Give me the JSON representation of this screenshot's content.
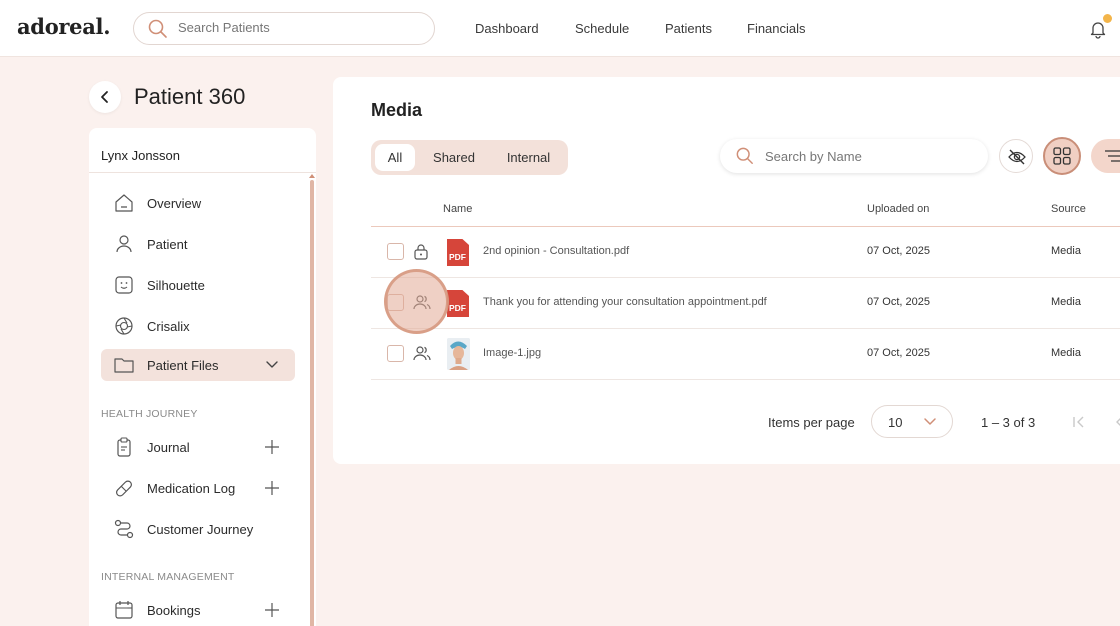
{
  "app": {
    "logo": "adoreal."
  },
  "header": {
    "search_placeholder": "Search Patients",
    "nav": [
      "Dashboard",
      "Schedule",
      "Patients",
      "Financials"
    ]
  },
  "page": {
    "title": "Patient 360"
  },
  "sidebar": {
    "patient_name": "Lynx Jonsson",
    "items": [
      {
        "label": "Overview",
        "icon": "home-icon"
      },
      {
        "label": "Patient",
        "icon": "person-icon"
      },
      {
        "label": "Silhouette",
        "icon": "face-scan-icon"
      },
      {
        "label": "Crisalix",
        "icon": "aperture-icon"
      },
      {
        "label": "Patient Files",
        "icon": "folder-icon",
        "active": true
      }
    ],
    "section_health": "HEALTH JOURNEY",
    "health_items": [
      {
        "label": "Journal",
        "icon": "clipboard-icon"
      },
      {
        "label": "Medication Log",
        "icon": "pill-icon"
      },
      {
        "label": "Customer Journey",
        "icon": "route-icon"
      }
    ],
    "section_internal": "INTERNAL MANAGEMENT",
    "internal_items": [
      {
        "label": "Bookings",
        "icon": "calendar-icon"
      }
    ]
  },
  "media": {
    "title": "Media",
    "tabs": [
      "All",
      "Shared",
      "Internal"
    ],
    "active_tab": "All",
    "search_placeholder": "Search by Name",
    "columns": {
      "name": "Name",
      "uploaded": "Uploaded on",
      "source": "Source"
    },
    "rows": [
      {
        "access": "lock-icon",
        "type": "pdf",
        "name": "2nd opinion - Consultation.pdf",
        "date": "07 Oct, 2025",
        "source": "Media"
      },
      {
        "access": "users-icon",
        "type": "pdf",
        "name": "Thank you for attending your consultation appointment.pdf",
        "date": "07 Oct, 2025",
        "source": "Media"
      },
      {
        "access": "users-icon",
        "type": "image",
        "name": "Image-1.jpg",
        "date": "07 Oct, 2025",
        "source": "Media"
      }
    ],
    "pagination": {
      "items_per_page_label": "Items per page",
      "items_per_page": "10",
      "range": "1 – 3 of 3"
    }
  },
  "colors": {
    "accent": "#d08f77",
    "background": "#fbf1ee",
    "pdf": "#d6453a",
    "notification": "#f3b54a"
  }
}
